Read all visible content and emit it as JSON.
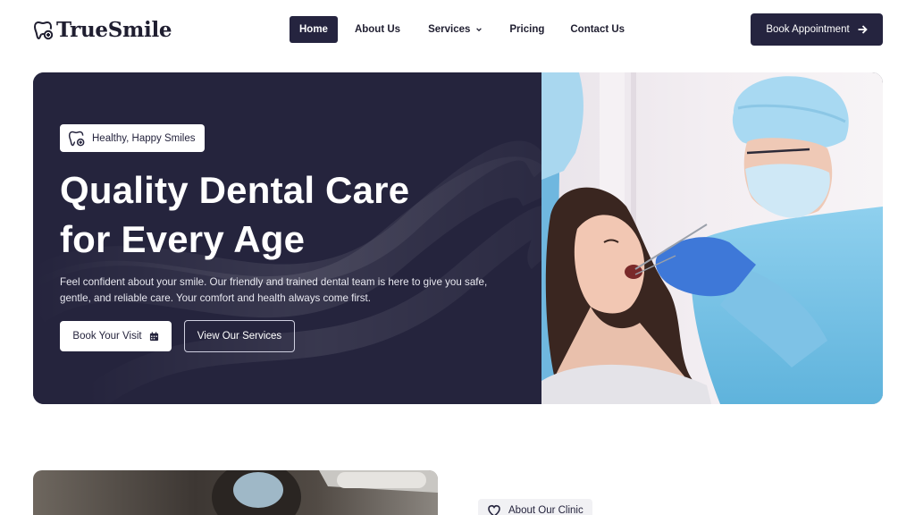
{
  "brand": {
    "name": "TrueSmile"
  },
  "nav": {
    "items": [
      {
        "label": "Home",
        "active": true
      },
      {
        "label": "About Us"
      },
      {
        "label": "Services",
        "has_dropdown": true
      },
      {
        "label": "Pricing"
      },
      {
        "label": "Contact Us"
      }
    ]
  },
  "header": {
    "cta_label": "Book Appointment",
    "cta_icon": "arrow-right-icon"
  },
  "hero": {
    "badge": "Healthy, Happy Smiles",
    "badge_icon": "tooth-plus-icon",
    "title_line1": "Quality Dental Care",
    "title_line2": "for Every Age",
    "description": "Feel confident about your smile. Our friendly and trained dental team is here to give you safe, gentle, and reliable care. Your comfort and health always come first.",
    "primary_button": "Book Your Visit",
    "primary_button_icon": "calendar-icon",
    "secondary_button": "View Our Services"
  },
  "about": {
    "badge": "About Our Clinic",
    "badge_icon": "heart-icon"
  },
  "colors": {
    "brand_dark": "#25243d",
    "white": "#ffffff",
    "scrub_blue": "#7fc4e6"
  }
}
